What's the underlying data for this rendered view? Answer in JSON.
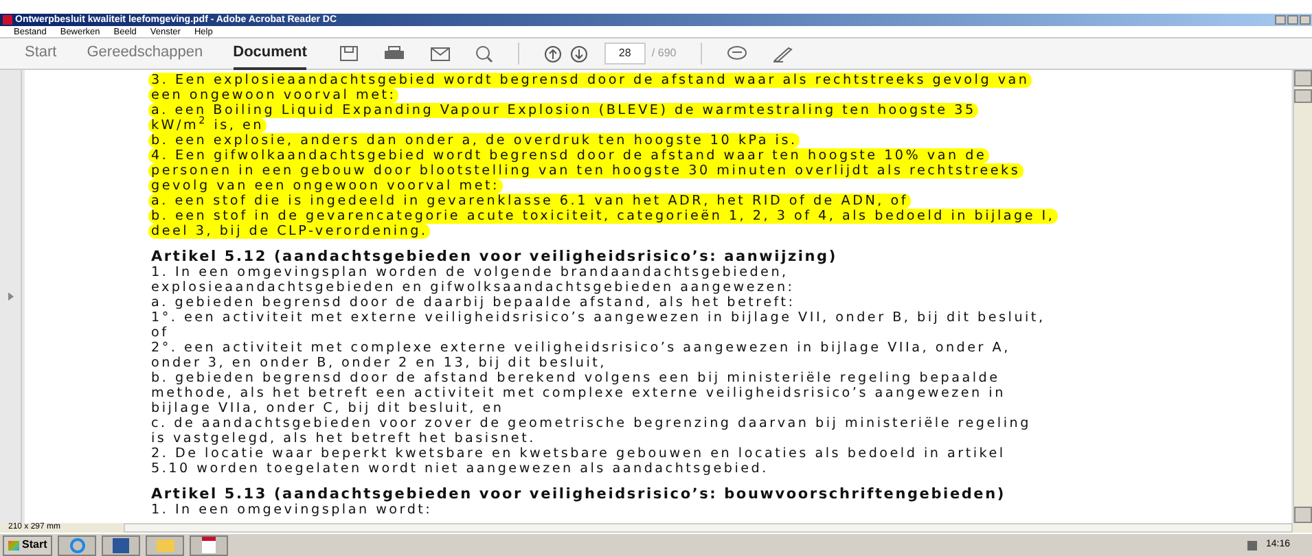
{
  "window": {
    "title": "Ontwerpbesluit kwaliteit leefomgeving.pdf - Adobe Acrobat Reader DC"
  },
  "menu": [
    "Bestand",
    "Bewerken",
    "Beeld",
    "Venster",
    "Help"
  ],
  "tabs": [
    {
      "label": "Start",
      "selected": false
    },
    {
      "label": "Gereedschappen",
      "selected": false
    },
    {
      "label": "Document",
      "selected": true
    }
  ],
  "page_number": "28",
  "page_total": "/ 690",
  "lines": [
    {
      "kind": "highlight",
      "text": "3. Een explosieaandachtsgebied wordt begrensd door de afstand waar als rechtstreeks gevolg van"
    },
    {
      "kind": "highlight",
      "text": "een ongewoon voorval met:"
    },
    {
      "kind": "highlight",
      "text": "a. een Boiling Liquid Expanding Vapour Explosion (BLEVE) de warmtestraling ten hoogste 35"
    },
    {
      "kind": "highlight",
      "text": "kW/m$^{2}$ is, en"
    },
    {
      "kind": "highlight",
      "text": "b. een explosie, anders dan onder a, de overdruk ten hoogste 10 kPa is."
    },
    {
      "kind": "highlight",
      "text": "4. Een gifwolkaandachtsgebied wordt begrensd door de afstand waar ten hoogste 10% van de"
    },
    {
      "kind": "highlight",
      "text": "personen in een gebouw door blootstelling van ten hoogste 30 minuten overlijdt als rechtstreeks"
    },
    {
      "kind": "highlight",
      "text": "gevolg van een ongewoon voorval met:"
    },
    {
      "kind": "highlight",
      "text": "a. een stof die is ingedeeld in gevarenklasse 6.1 van het ADR, het RID of de ADN, of"
    },
    {
      "kind": "highlight",
      "text": "b. een stof in de gevarencategorie acute toxiciteit, categorieën 1, 2, 3 of 4, als bedoeld in bijlage I,"
    },
    {
      "kind": "highlight",
      "text": "deel 3, bij de CLP-verordening."
    },
    {
      "kind": "heading",
      "text": "Artikel 5.12 (aandachtsgebieden voor veiligheidsrisico’s: aanwijzing)"
    },
    {
      "kind": "text",
      "text": "1. In een omgevingsplan worden de volgende brandaandachtsgebieden,"
    },
    {
      "kind": "text",
      "text": "explosieaandachtsgebieden en gifwolksaandachtsgebieden aangewezen:"
    },
    {
      "kind": "text",
      "text": "a. gebieden begrensd door de daarbij bepaalde afstand, als het betreft:"
    },
    {
      "kind": "text",
      "text": "1°. een activiteit met externe veiligheidsrisico’s aangewezen in bijlage VII, onder B, bij dit besluit,"
    },
    {
      "kind": "text",
      "text": "of"
    },
    {
      "kind": "text",
      "text": "2°. een activiteit met complexe externe veiligheidsrisico’s aangewezen in bijlage VIIa, onder A,"
    },
    {
      "kind": "text",
      "text": "onder 3, en onder B, onder 2 en 13, bij dit besluit,"
    },
    {
      "kind": "text",
      "text": "b. gebieden begrensd door de afstand berekend volgens een bij ministeriële regeling bepaalde"
    },
    {
      "kind": "text",
      "text": "methode, als het betreft een activiteit met complexe externe veiligheidsrisico’s aangewezen in"
    },
    {
      "kind": "text",
      "text": "bijlage VIIa, onder C, bij dit besluit, en"
    },
    {
      "kind": "text",
      "text": "c. de aandachtsgebieden voor zover de geometrische begrenzing daarvan bij ministeriële regeling"
    },
    {
      "kind": "text",
      "text": "is vastgelegd, als het betreft het basisnet."
    },
    {
      "kind": "text",
      "text": "2. De locatie waar beperkt kwetsbare en kwetsbare gebouwen en locaties als bedoeld in artikel"
    },
    {
      "kind": "text",
      "text": "5.10 worden toegelaten wordt niet aangewezen als aandachtsgebied."
    },
    {
      "kind": "heading",
      "text": "Artikel 5.13 (aandachtsgebieden voor veiligheidsrisico’s: bouwvoorschriftengebieden)"
    },
    {
      "kind": "text",
      "text": "1. In een omgevingsplan wordt:"
    }
  ],
  "page_size": "210 x 297 mm",
  "taskbar": {
    "start": "Start",
    "clock": "14:16"
  }
}
